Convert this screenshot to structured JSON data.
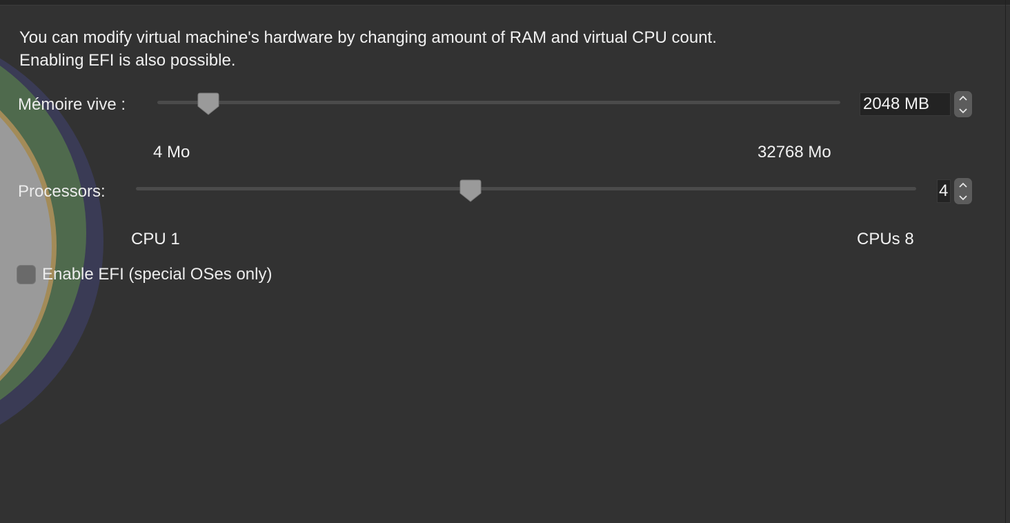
{
  "description": {
    "line1": "You can modify virtual machine's hardware by changing amount of RAM and virtual CPU count.",
    "line2": "Enabling EFI is also possible."
  },
  "memory": {
    "label": "Mémoire vive :",
    "value": "2048 MB",
    "min_label": "4 Mo",
    "max_label": "32768 Mo",
    "slider_fraction": 0.075
  },
  "processors": {
    "label": "Processors:",
    "value": "4",
    "min_label": "CPU 1",
    "max_label": "CPUs 8",
    "slider_fraction": 0.429
  },
  "efi": {
    "label": "Enable EFI (special OSes only)",
    "checked": false
  },
  "icons": {
    "stepper_up": "chevron-up-icon",
    "stepper_down": "chevron-down-icon"
  },
  "colors": {
    "window_background": "#323232",
    "track": "#4b4b4b",
    "thumb": "#9a9a9a",
    "field_background": "#232323"
  }
}
